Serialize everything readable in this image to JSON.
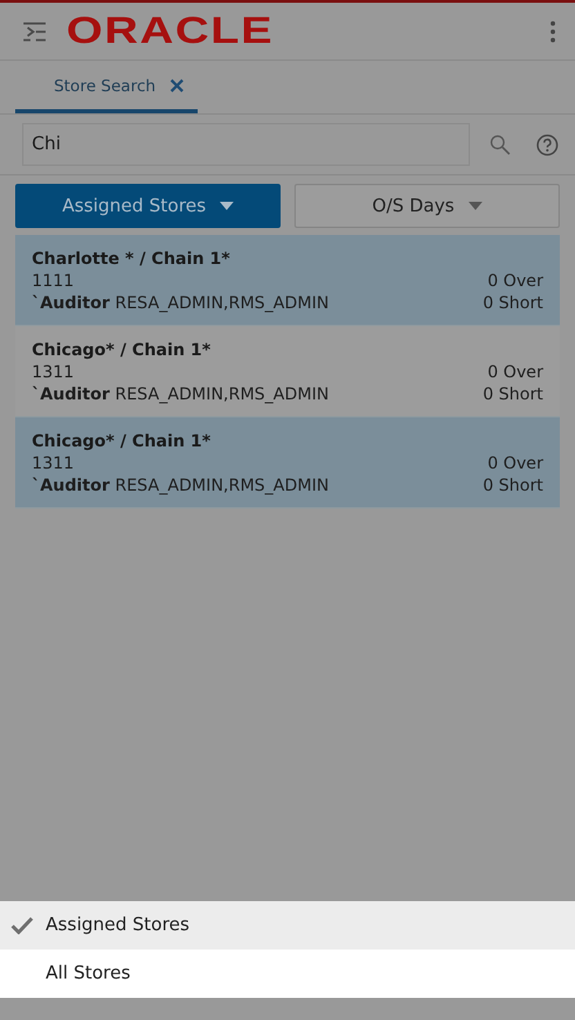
{
  "header": {
    "logo": "ORACLE"
  },
  "tabs": [
    {
      "label": "Store Search",
      "selected": true,
      "closable": true
    }
  ],
  "search": {
    "value": "Chi"
  },
  "filters": [
    {
      "label": "Assigned Stores",
      "primary": true
    },
    {
      "label": "O/S Days",
      "primary": false
    }
  ],
  "stores": [
    {
      "name": "Charlotte * / Chain 1*",
      "number": "1111",
      "role": "`Auditor",
      "roles": "RESA_ADMIN,RMS_ADMIN",
      "over": "0 Over",
      "short": "0 Short",
      "selected": true
    },
    {
      "name": "Chicago* / Chain 1*",
      "number": "1311",
      "role": "`Auditor",
      "roles": "RESA_ADMIN,RMS_ADMIN",
      "over": "0 Over",
      "short": "0 Short",
      "selected": false
    },
    {
      "name": "Chicago* / Chain 1*",
      "number": "1311",
      "role": "`Auditor",
      "roles": "RESA_ADMIN,RMS_ADMIN",
      "over": "0 Over",
      "short": "0 Short",
      "selected": true
    }
  ],
  "menu": [
    {
      "label": "Assigned Stores",
      "selected": true
    },
    {
      "label": "All Stores",
      "selected": false
    }
  ]
}
